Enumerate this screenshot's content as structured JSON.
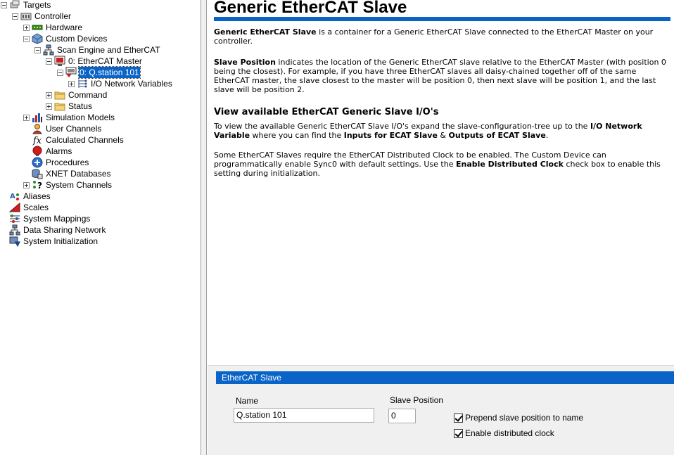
{
  "tree": [
    {
      "label": "Targets",
      "icon": "targets-icon",
      "expander": "minus"
    },
    {
      "label": "Controller",
      "icon": "controller-icon",
      "expander": "minus"
    },
    {
      "label": "Hardware",
      "icon": "hardware-icon",
      "expander": "plus"
    },
    {
      "label": "Custom Devices",
      "icon": "custom-devices-icon",
      "expander": "minus"
    },
    {
      "label": "Scan Engine and EtherCAT",
      "icon": "network-icon",
      "expander": "minus"
    },
    {
      "label": "0: EtherCAT Master",
      "icon": "ethercat-master-icon",
      "expander": "minus"
    },
    {
      "label": "0: Q.station 101",
      "icon": "ethercat-slave-icon",
      "expander": "minus",
      "selected": true
    },
    {
      "label": "I/O Network Variables",
      "icon": "io-variables-icon",
      "expander": "plus"
    },
    {
      "label": "Command",
      "icon": "folder-icon",
      "expander": "plus"
    },
    {
      "label": "Status",
      "icon": "folder-icon",
      "expander": "plus"
    },
    {
      "label": "Simulation Models",
      "icon": "simulation-models-icon",
      "expander": "plus"
    },
    {
      "label": "User Channels",
      "icon": "user-channels-icon",
      "expander": "none"
    },
    {
      "label": "Calculated Channels",
      "icon": "function-icon",
      "expander": "none"
    },
    {
      "label": "Alarms",
      "icon": "alarm-icon",
      "expander": "none"
    },
    {
      "label": "Procedures",
      "icon": "procedures-icon",
      "expander": "none"
    },
    {
      "label": "XNET Databases",
      "icon": "database-icon",
      "expander": "none"
    },
    {
      "label": "System Channels",
      "icon": "system-channels-icon",
      "expander": "plus"
    },
    {
      "label": "Aliases",
      "icon": "aliases-icon",
      "expander": "none"
    },
    {
      "label": "Scales",
      "icon": "scales-icon",
      "expander": "none"
    },
    {
      "label": "System Mappings",
      "icon": "mappings-icon",
      "expander": "none"
    },
    {
      "label": "Data Sharing Network",
      "icon": "data-sharing-icon",
      "expander": "none"
    },
    {
      "label": "System Initialization",
      "icon": "initialization-icon",
      "expander": "none"
    }
  ],
  "help": {
    "title": "Generic EtherCAT Slave",
    "p1_bold": "Generic EtherCAT Slave",
    "p1_text": " is a container for a Generic EtherCAT Slave connected to the EtherCAT Master on your controller.",
    "p2_bold": "Slave Position",
    "p2_text": " indicates the location of the Generic EtherCAT slave relative to the EtherCAT Master (with position 0 being the closest). For example, if you have three EtherCAT slaves all daisy-chained together off of the same EtherCAT master, the slave closest to the master will be position 0, then next slave will be position 1, and the last slave will be position 2.",
    "subheading": "View available EtherCAT Generic Slave I/O's",
    "p3_a": "To view the available Generic EtherCAT Slave I/O's expand the slave-configuration-tree up to the ",
    "p3_b": "I/O Network Variable",
    "p3_c": " where you can find the ",
    "p3_d": "Inputs for ECAT Slave",
    "p3_e": " & ",
    "p3_f": "Outputs of ECAT Slave",
    "p3_g": ".",
    "p4_a": "Some EtherCAT Slaves require the EtherCAT Distributed Clock to be enabled. The Custom Device can programmatically enable Sync0 with default settings. Use the ",
    "p4_b": "Enable Distributed Clock",
    "p4_c": " check box to enable this setting during initialization."
  },
  "panel": {
    "header": "EtherCAT Slave",
    "name_label": "Name",
    "name_value": "Q.station 101",
    "slave_position_label": "Slave Position",
    "slave_position_value": "0",
    "prepend_label": "Prepend slave position to name",
    "prepend_checked": true,
    "distributed_clock_label": "Enable distributed clock",
    "distributed_clock_checked": true
  },
  "colors": {
    "accent": "#0a64c8",
    "panel_bg": "#f0f0f0"
  }
}
